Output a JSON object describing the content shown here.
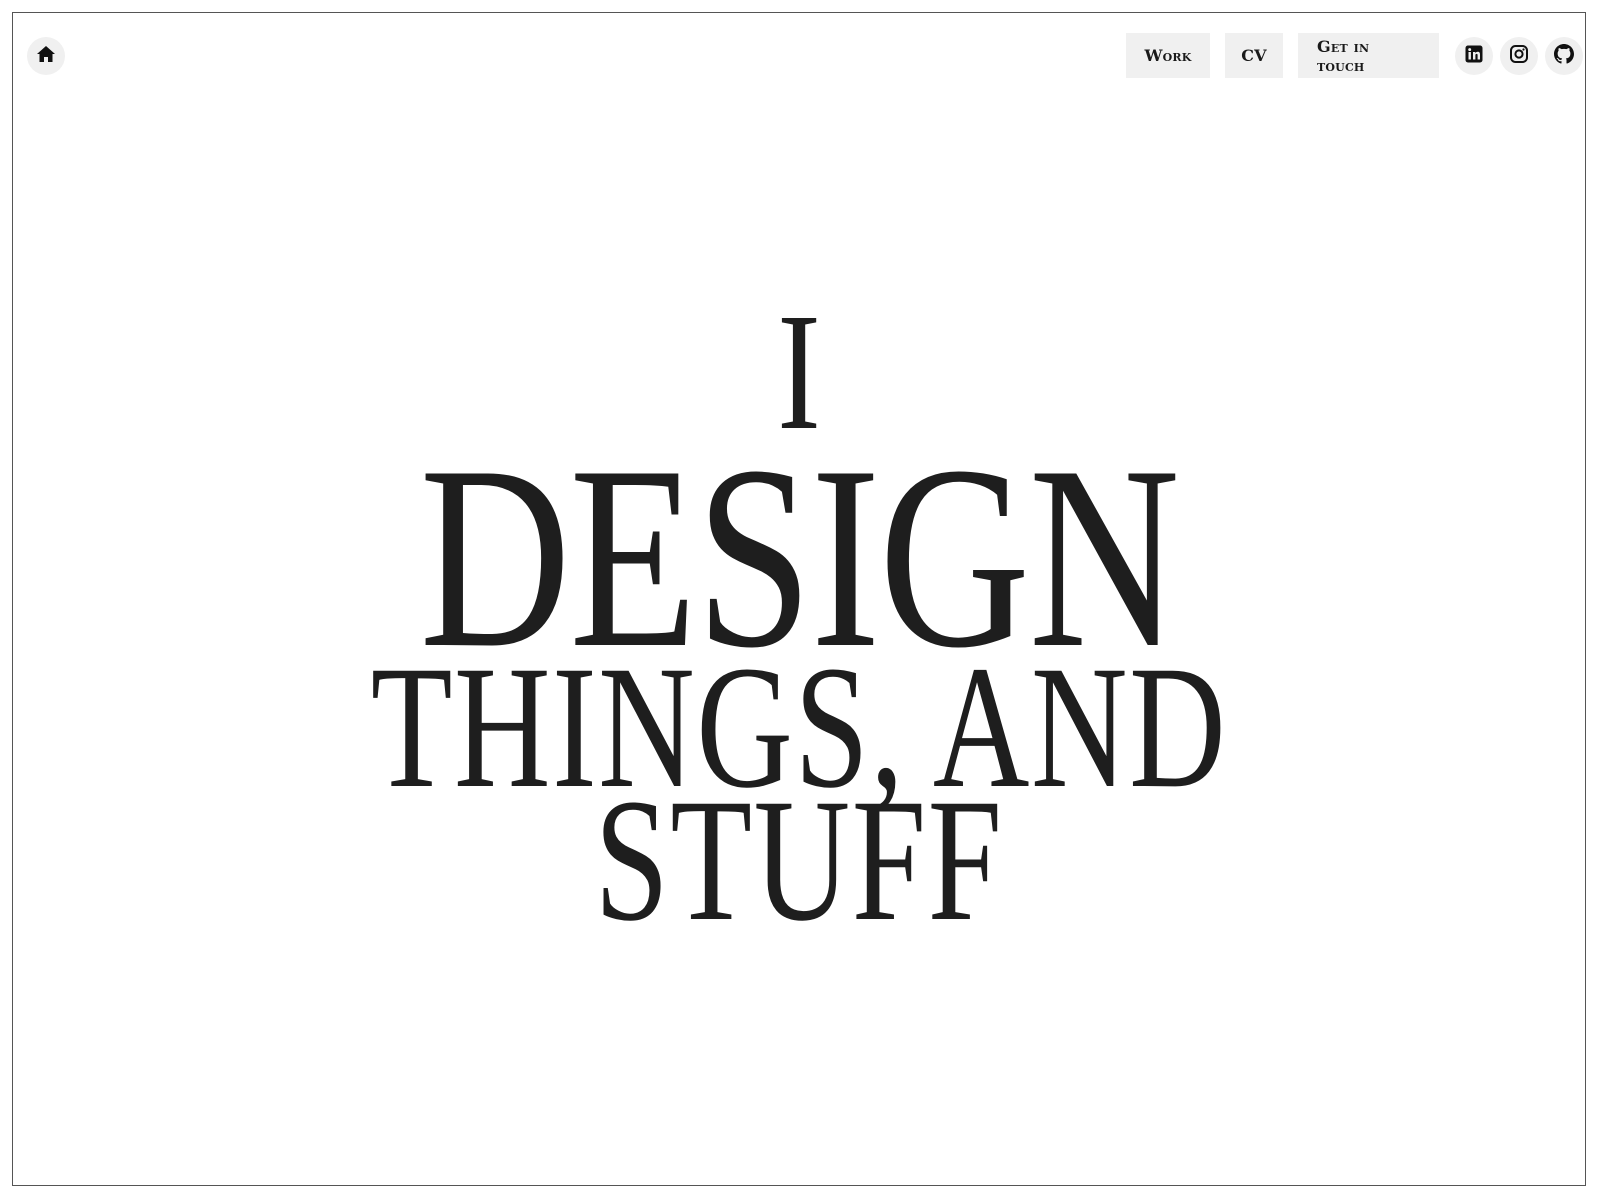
{
  "nav": {
    "home_icon": "home-icon",
    "items": [
      {
        "label": "Work"
      },
      {
        "label": "CV"
      },
      {
        "label": "Get in touch"
      }
    ],
    "social": [
      {
        "icon": "linkedin-icon"
      },
      {
        "icon": "instagram-icon"
      },
      {
        "icon": "github-icon"
      }
    ]
  },
  "hero": {
    "line1": "I",
    "line2": "DESIGN",
    "line3": "THINGS, AND",
    "line4": "STUFF"
  },
  "colors": {
    "text": "#1e1e1e",
    "button_bg": "#f0f0f0",
    "background": "#ffffff",
    "frame_border": "#555555"
  }
}
